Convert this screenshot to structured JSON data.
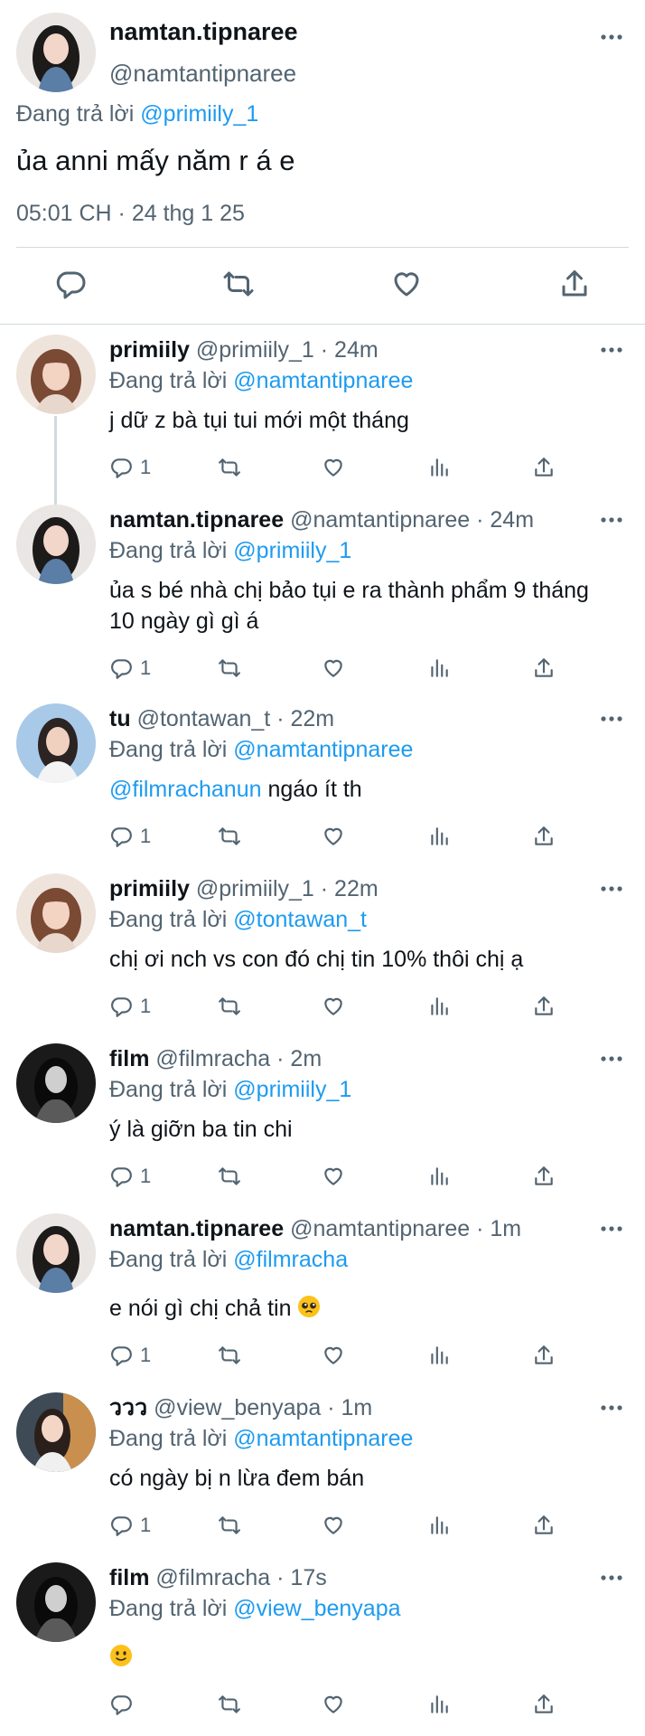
{
  "colors": {
    "link": "#1d9bf0",
    "secondary": "#536471",
    "text": "#0f1419",
    "divider": "#cfd9de"
  },
  "main_tweet": {
    "display_name": "namtan.tipnaree",
    "handle": "@namtantipnaree",
    "replying_label": "Đang trả lời",
    "replying_to": "@primiily_1",
    "text": "ủa anni mấy năm r á e",
    "timestamp": "05:01 CH · 24 thg 1 25",
    "icons": [
      "reply-icon",
      "retweet-icon",
      "like-icon",
      "share-icon"
    ]
  },
  "replies": [
    {
      "name": "primiily",
      "handle": "@primiily_1 · 24m",
      "replying_label": "Đang trả lời",
      "replying_to": "@namtantipnaree",
      "mention": "",
      "text": "j dữ z bà tụi tui mới một tháng",
      "emoji": "",
      "reply_count": "1"
    },
    {
      "name": "namtan.tipnaree",
      "handle": "@namtantipnaree · 24m",
      "replying_label": "Đang trả lời",
      "replying_to": "@primiily_1",
      "mention": "",
      "text": "ủa s bé nhà chị bảo tụi e ra thành phẩm 9 tháng 10 ngày gì gì á",
      "emoji": "",
      "reply_count": "1"
    },
    {
      "name": "tu",
      "handle": "@tontawan_t · 22m",
      "replying_label": "Đang trả lời",
      "replying_to": "@namtantipnaree",
      "mention": "@filmrachanun",
      "text": " ngáo ít th",
      "emoji": "",
      "reply_count": "1"
    },
    {
      "name": "primiily",
      "handle": "@primiily_1 · 22m",
      "replying_label": "Đang trả lời",
      "replying_to": "@tontawan_t",
      "mention": "",
      "text": "chị ơi nch vs con đó chị tin 10% thôi chị ạ",
      "emoji": "",
      "reply_count": "1"
    },
    {
      "name": "film",
      "handle": "@filmracha · 2m",
      "replying_label": "Đang trả lời",
      "replying_to": "@primiily_1",
      "mention": "",
      "text": "ý là giỡn ba tin chi",
      "emoji": "",
      "reply_count": "1"
    },
    {
      "name": "namtan.tipnaree",
      "handle": "@namtantipnaree · 1m",
      "replying_label": "Đang trả lời",
      "replying_to": "@filmracha",
      "mention": "",
      "text": "e nói gì chị chả tin ",
      "emoji": "pleading-face-emoji",
      "reply_count": "1"
    },
    {
      "name": "ววว",
      "handle": "@view_benyapa · 1m",
      "replying_label": "Đang trả lời",
      "replying_to": "@namtantipnaree",
      "mention": "",
      "text": "có ngày bị n lừa đem bán",
      "emoji": "",
      "reply_count": "1"
    },
    {
      "name": "film",
      "handle": "@filmracha · 17s",
      "replying_label": "Đang trả lời",
      "replying_to": "@view_benyapa",
      "mention": "",
      "text": "",
      "emoji": "slightly-smiling-face-emoji",
      "reply_count": ""
    }
  ]
}
